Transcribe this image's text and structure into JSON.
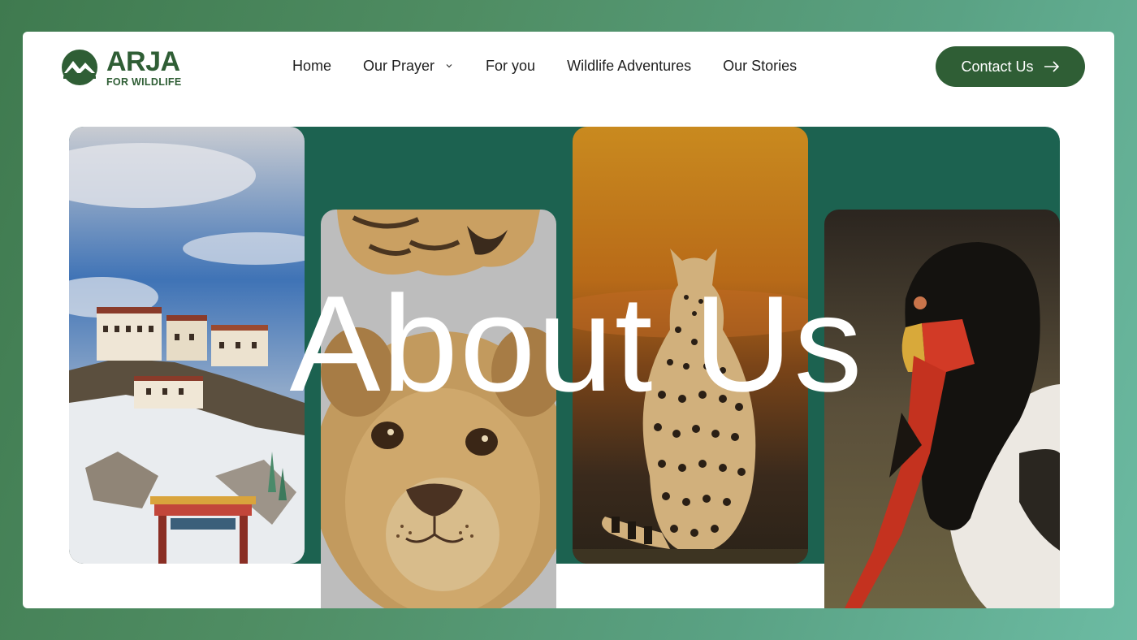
{
  "brand": {
    "name": "ARJA",
    "tagline": "FOR WILDLIFE",
    "color": "#2f5e35"
  },
  "nav": {
    "items": [
      {
        "label": "Home",
        "has_dropdown": false
      },
      {
        "label": "Our Prayer",
        "has_dropdown": true
      },
      {
        "label": "For you",
        "has_dropdown": false
      },
      {
        "label": "Wildlife Adventures",
        "has_dropdown": false
      },
      {
        "label": "Our Stories",
        "has_dropdown": false
      }
    ],
    "dropdown_icon": "chevron-down-icon"
  },
  "cta": {
    "label": "Contact Us",
    "icon": "arrow-right-icon",
    "color": "#2f5e35"
  },
  "hero": {
    "title": "About Us",
    "panel_color": "#1c6250",
    "photos": [
      {
        "subject": "monastery-on-snowy-hill"
      },
      {
        "subject": "lion-cub"
      },
      {
        "subject": "cheetah-sunset"
      },
      {
        "subject": "saddle-billed-stork"
      }
    ]
  }
}
